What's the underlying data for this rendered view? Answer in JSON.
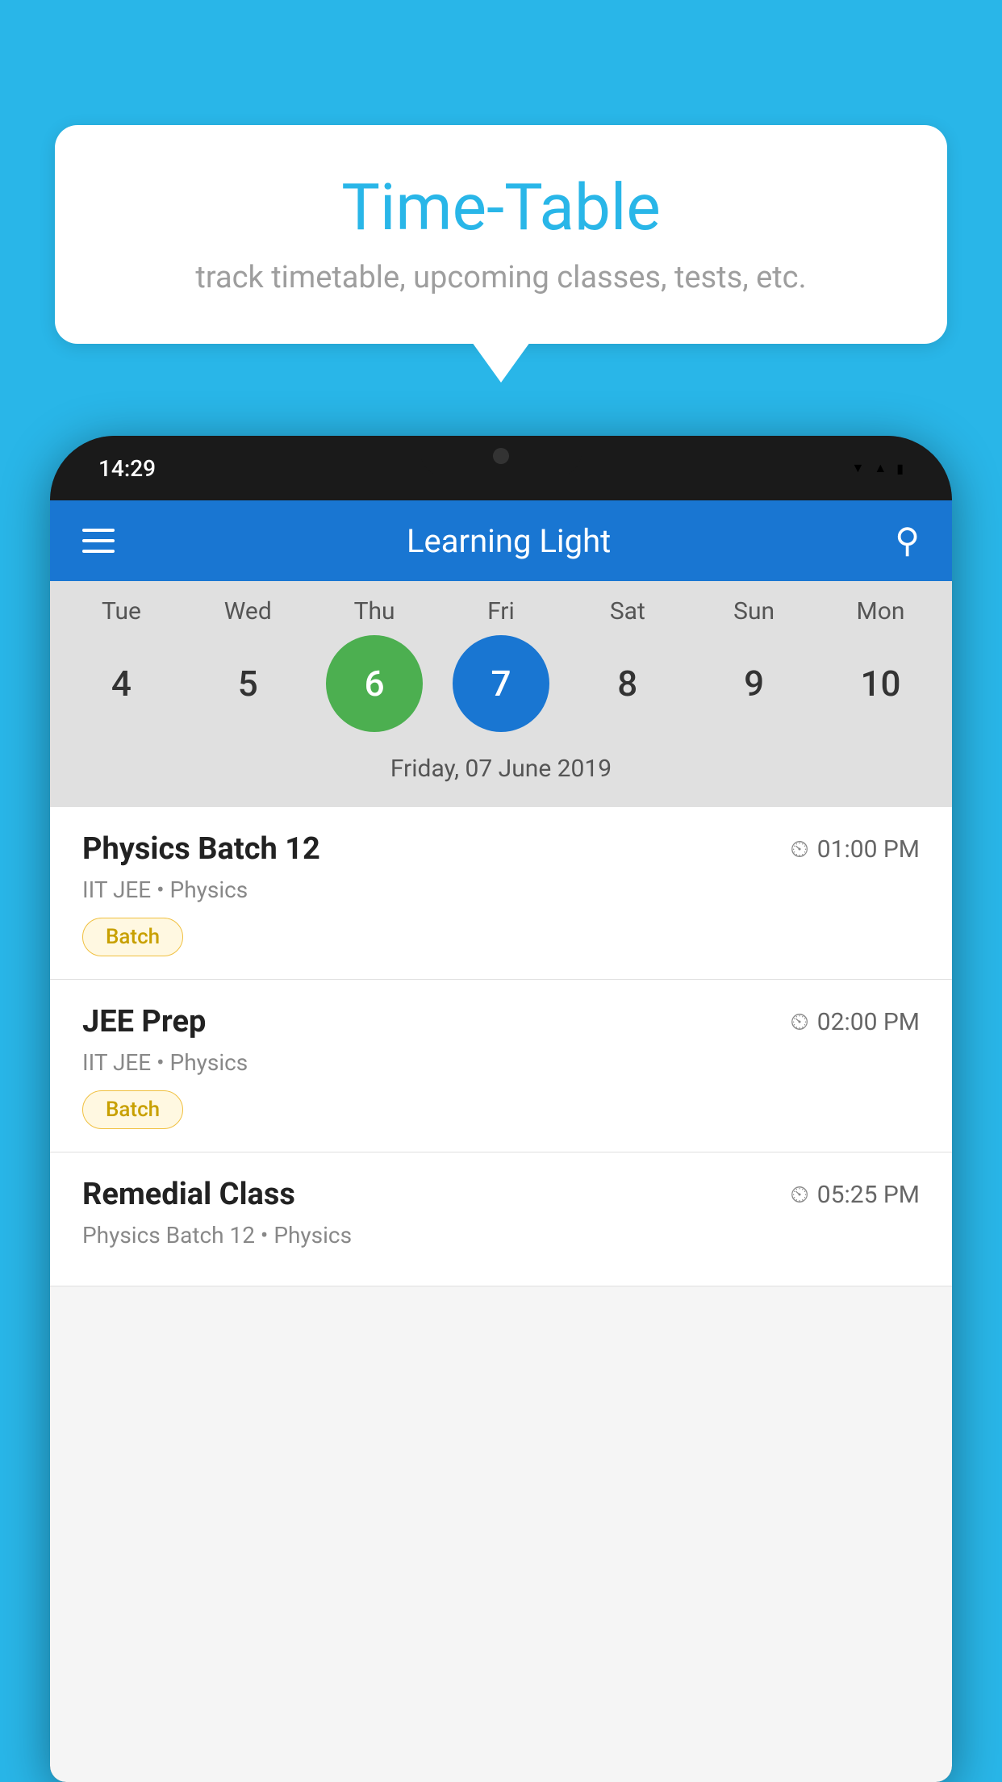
{
  "background_color": "#29b6e8",
  "speech_bubble": {
    "title": "Time-Table",
    "subtitle": "track timetable, upcoming classes, tests, etc."
  },
  "phone": {
    "status_bar": {
      "time": "14:29"
    },
    "app_header": {
      "title": "Learning Light"
    },
    "calendar": {
      "days": [
        "Tue",
        "Wed",
        "Thu",
        "Fri",
        "Sat",
        "Sun",
        "Mon"
      ],
      "dates": [
        "4",
        "5",
        "6",
        "7",
        "8",
        "9",
        "10"
      ],
      "today_index": 2,
      "selected_index": 3,
      "selected_date_label": "Friday, 07 June 2019"
    },
    "schedule_items": [
      {
        "title": "Physics Batch 12",
        "time": "01:00 PM",
        "subtitle": "IIT JEE • Physics",
        "tag": "Batch"
      },
      {
        "title": "JEE Prep",
        "time": "02:00 PM",
        "subtitle": "IIT JEE • Physics",
        "tag": "Batch"
      },
      {
        "title": "Remedial Class",
        "time": "05:25 PM",
        "subtitle": "Physics Batch 12 • Physics",
        "tag": null
      }
    ]
  }
}
